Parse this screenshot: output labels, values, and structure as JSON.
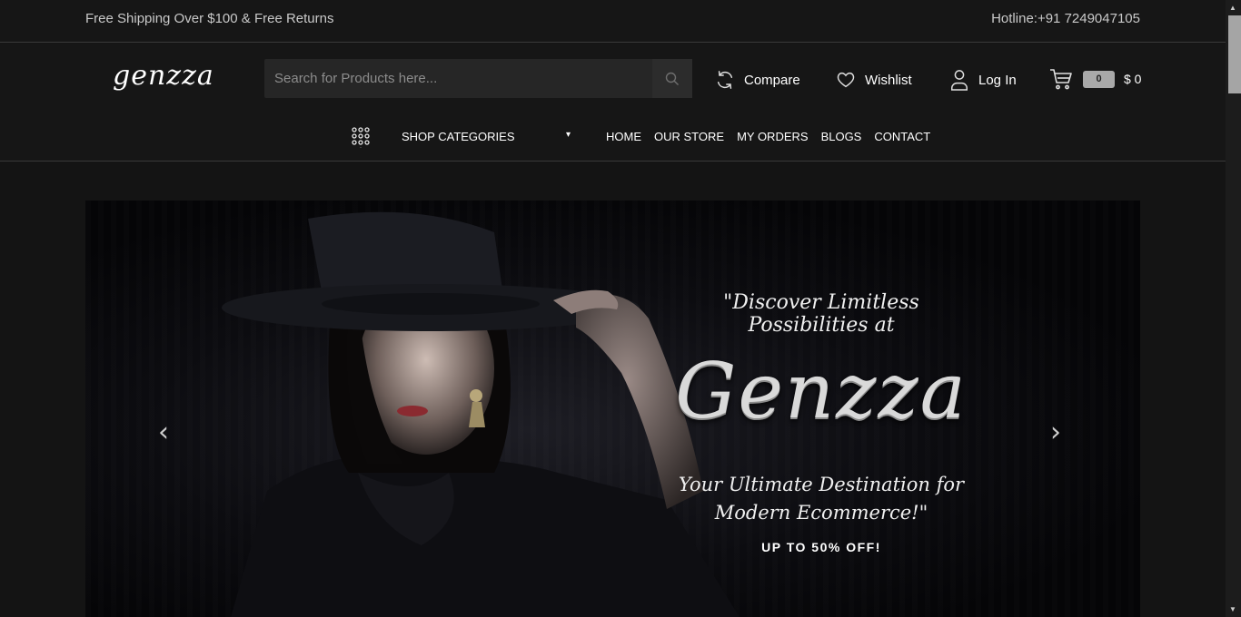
{
  "topbar": {
    "shipping": "Free Shipping Over $100 & Free Returns",
    "hotline": "Hotline:+91 7249047105"
  },
  "header": {
    "logo": "genzza",
    "search_placeholder": "Search for Products here...",
    "compare": "Compare",
    "wishlist": "Wishlist",
    "login": "Log In",
    "cart_count": "0",
    "cart_total": "$ 0"
  },
  "nav": {
    "categories": "SHOP CATEGORIES",
    "links": [
      "HOME",
      "OUR STORE",
      "MY ORDERS",
      "BLOGS",
      "CONTACT"
    ]
  },
  "hero": {
    "line1": "\"Discover Limitless Possibilities at",
    "brand": "Genzza",
    "line2": "Your Ultimate Destination for Modern Ecommerce!\"",
    "offer": "UP TO 50% OFF!"
  },
  "icons": {
    "search": "search-icon",
    "compare": "refresh-icon",
    "wishlist": "heart-icon",
    "login": "user-icon",
    "cart": "cart-icon",
    "categories": "grid-dots-icon",
    "prev": "chevron-left-icon",
    "next": "chevron-right-icon"
  }
}
